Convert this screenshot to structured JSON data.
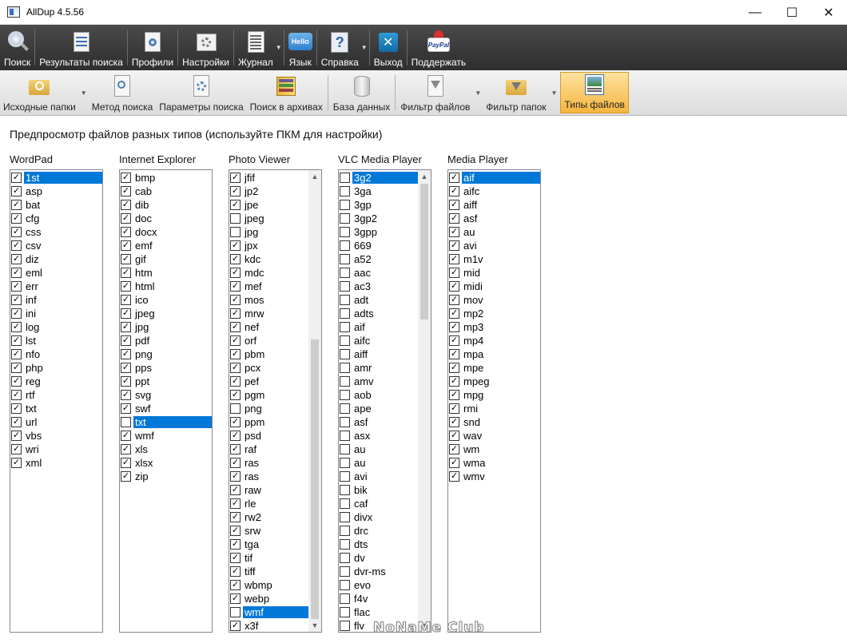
{
  "window": {
    "title": "AllDup 4.5.56",
    "controls": {
      "minimize": "—",
      "maximize": "☐",
      "close": "✕"
    }
  },
  "toolbar_main": {
    "items": [
      {
        "label": "Поиск",
        "icon": "magnifier-icon",
        "dropdown": false
      },
      {
        "label": "Результаты поиска",
        "icon": "results-icon",
        "dropdown": false
      },
      {
        "label": "Профили",
        "icon": "profiles-icon",
        "dropdown": false
      },
      {
        "label": "Настройки",
        "icon": "settings-icon",
        "dropdown": false
      },
      {
        "label": "Журнал",
        "icon": "log-icon",
        "dropdown": true
      },
      {
        "label": "Язык",
        "icon": "language-hello-icon",
        "dropdown": false
      },
      {
        "label": "Справка",
        "icon": "help-icon",
        "dropdown": true
      },
      {
        "label": "Выход",
        "icon": "exit-icon",
        "dropdown": false
      },
      {
        "label": "Поддержать",
        "icon": "paypal-icon",
        "dropdown": false
      }
    ]
  },
  "toolbar_secondary": {
    "items": [
      {
        "label": "Исходные папки",
        "icon": "source-folders-icon",
        "dropdown": true,
        "active": false
      },
      {
        "label": "Метод поиска",
        "icon": "search-method-icon",
        "dropdown": false,
        "active": false
      },
      {
        "label": "Параметры поиска",
        "icon": "search-params-icon",
        "dropdown": false,
        "active": false
      },
      {
        "label": "Поиск в архивах",
        "icon": "archive-icon",
        "dropdown": false,
        "active": false
      },
      {
        "label": "База данных",
        "icon": "database-icon",
        "dropdown": false,
        "active": false
      },
      {
        "label": "Фильтр файлов",
        "icon": "file-filter-icon",
        "dropdown": true,
        "active": false
      },
      {
        "label": "Фильтр папок",
        "icon": "folder-filter-icon",
        "dropdown": true,
        "active": false
      },
      {
        "label": "Типы файлов",
        "icon": "file-types-icon",
        "dropdown": false,
        "active": true
      }
    ]
  },
  "content": {
    "heading": "Предпросмотр файлов разных типов (используйте ПКМ для настройки)",
    "columns": [
      {
        "label": "WordPad",
        "scrollbar": false,
        "items": [
          {
            "ext": "1st",
            "checked": true,
            "selected": true
          },
          {
            "ext": "asp",
            "checked": true
          },
          {
            "ext": "bat",
            "checked": true
          },
          {
            "ext": "cfg",
            "checked": true
          },
          {
            "ext": "css",
            "checked": true
          },
          {
            "ext": "csv",
            "checked": true
          },
          {
            "ext": "diz",
            "checked": true
          },
          {
            "ext": "eml",
            "checked": true
          },
          {
            "ext": "err",
            "checked": true
          },
          {
            "ext": "inf",
            "checked": true
          },
          {
            "ext": "ini",
            "checked": true
          },
          {
            "ext": "log",
            "checked": true
          },
          {
            "ext": "lst",
            "checked": true
          },
          {
            "ext": "nfo",
            "checked": true
          },
          {
            "ext": "php",
            "checked": true
          },
          {
            "ext": "reg",
            "checked": true
          },
          {
            "ext": "rtf",
            "checked": true
          },
          {
            "ext": "txt",
            "checked": true
          },
          {
            "ext": "url",
            "checked": true
          },
          {
            "ext": "vbs",
            "checked": true
          },
          {
            "ext": "wri",
            "checked": true
          },
          {
            "ext": "xml",
            "checked": true
          }
        ]
      },
      {
        "label": "Internet Explorer",
        "scrollbar": false,
        "items": [
          {
            "ext": "bmp",
            "checked": true
          },
          {
            "ext": "cab",
            "checked": true
          },
          {
            "ext": "dib",
            "checked": true
          },
          {
            "ext": "doc",
            "checked": true
          },
          {
            "ext": "docx",
            "checked": true
          },
          {
            "ext": "emf",
            "checked": true
          },
          {
            "ext": "gif",
            "checked": true
          },
          {
            "ext": "htm",
            "checked": true
          },
          {
            "ext": "html",
            "checked": true
          },
          {
            "ext": "ico",
            "checked": true
          },
          {
            "ext": "jpeg",
            "checked": true
          },
          {
            "ext": "jpg",
            "checked": true
          },
          {
            "ext": "pdf",
            "checked": true
          },
          {
            "ext": "png",
            "checked": true
          },
          {
            "ext": "pps",
            "checked": true
          },
          {
            "ext": "ppt",
            "checked": true
          },
          {
            "ext": "svg",
            "checked": true
          },
          {
            "ext": "swf",
            "checked": true
          },
          {
            "ext": "txt",
            "checked": false,
            "selected": true
          },
          {
            "ext": "wmf",
            "checked": true
          },
          {
            "ext": "xls",
            "checked": true
          },
          {
            "ext": "xlsx",
            "checked": true
          },
          {
            "ext": "zip",
            "checked": true
          }
        ]
      },
      {
        "label": "Photo Viewer",
        "scrollbar": true,
        "items": [
          {
            "ext": "jfif",
            "checked": true
          },
          {
            "ext": "jp2",
            "checked": true
          },
          {
            "ext": "jpe",
            "checked": true
          },
          {
            "ext": "jpeg",
            "checked": false
          },
          {
            "ext": "jpg",
            "checked": false
          },
          {
            "ext": "jpx",
            "checked": true
          },
          {
            "ext": "kdc",
            "checked": true
          },
          {
            "ext": "mdc",
            "checked": true
          },
          {
            "ext": "mef",
            "checked": true
          },
          {
            "ext": "mos",
            "checked": true
          },
          {
            "ext": "mrw",
            "checked": true
          },
          {
            "ext": "nef",
            "checked": true
          },
          {
            "ext": "orf",
            "checked": true
          },
          {
            "ext": "pbm",
            "checked": true
          },
          {
            "ext": "pcx",
            "checked": true
          },
          {
            "ext": "pef",
            "checked": true
          },
          {
            "ext": "pgm",
            "checked": true
          },
          {
            "ext": "png",
            "checked": false
          },
          {
            "ext": "ppm",
            "checked": true
          },
          {
            "ext": "psd",
            "checked": true
          },
          {
            "ext": "raf",
            "checked": true
          },
          {
            "ext": "ras",
            "checked": true
          },
          {
            "ext": "ras",
            "checked": true
          },
          {
            "ext": "raw",
            "checked": true
          },
          {
            "ext": "rle",
            "checked": true
          },
          {
            "ext": "rw2",
            "checked": true
          },
          {
            "ext": "srw",
            "checked": true
          },
          {
            "ext": "tga",
            "checked": true
          },
          {
            "ext": "tif",
            "checked": true
          },
          {
            "ext": "tiff",
            "checked": true
          },
          {
            "ext": "wbmp",
            "checked": true
          },
          {
            "ext": "webp",
            "checked": true
          },
          {
            "ext": "wmf",
            "checked": false,
            "selected": true
          },
          {
            "ext": "x3f",
            "checked": true
          }
        ]
      },
      {
        "label": "VLC Media Player",
        "scrollbar": true,
        "items": [
          {
            "ext": "3g2",
            "checked": false,
            "selected": true
          },
          {
            "ext": "3ga",
            "checked": false
          },
          {
            "ext": "3gp",
            "checked": false
          },
          {
            "ext": "3gp2",
            "checked": false
          },
          {
            "ext": "3gpp",
            "checked": false
          },
          {
            "ext": "669",
            "checked": false
          },
          {
            "ext": "a52",
            "checked": false
          },
          {
            "ext": "aac",
            "checked": false
          },
          {
            "ext": "ac3",
            "checked": false
          },
          {
            "ext": "adt",
            "checked": false
          },
          {
            "ext": "adts",
            "checked": false
          },
          {
            "ext": "aif",
            "checked": false
          },
          {
            "ext": "aifc",
            "checked": false
          },
          {
            "ext": "aiff",
            "checked": false
          },
          {
            "ext": "amr",
            "checked": false
          },
          {
            "ext": "amv",
            "checked": false
          },
          {
            "ext": "aob",
            "checked": false
          },
          {
            "ext": "ape",
            "checked": false
          },
          {
            "ext": "asf",
            "checked": false
          },
          {
            "ext": "asx",
            "checked": false
          },
          {
            "ext": "au",
            "checked": false
          },
          {
            "ext": "au",
            "checked": false
          },
          {
            "ext": "avi",
            "checked": false
          },
          {
            "ext": "bik",
            "checked": false
          },
          {
            "ext": "caf",
            "checked": false
          },
          {
            "ext": "divx",
            "checked": false
          },
          {
            "ext": "drc",
            "checked": false
          },
          {
            "ext": "dts",
            "checked": false
          },
          {
            "ext": "dv",
            "checked": false
          },
          {
            "ext": "dvr-ms",
            "checked": false
          },
          {
            "ext": "evo",
            "checked": false
          },
          {
            "ext": "f4v",
            "checked": false
          },
          {
            "ext": "flac",
            "checked": false
          },
          {
            "ext": "flv",
            "checked": false
          }
        ]
      },
      {
        "label": "Media Player",
        "scrollbar": false,
        "items": [
          {
            "ext": "aif",
            "checked": true,
            "selected": true
          },
          {
            "ext": "aifc",
            "checked": true
          },
          {
            "ext": "aiff",
            "checked": true
          },
          {
            "ext": "asf",
            "checked": true
          },
          {
            "ext": "au",
            "checked": true
          },
          {
            "ext": "avi",
            "checked": true
          },
          {
            "ext": "m1v",
            "checked": true
          },
          {
            "ext": "mid",
            "checked": true
          },
          {
            "ext": "midi",
            "checked": true
          },
          {
            "ext": "mov",
            "checked": true
          },
          {
            "ext": "mp2",
            "checked": true
          },
          {
            "ext": "mp3",
            "checked": true
          },
          {
            "ext": "mp4",
            "checked": true
          },
          {
            "ext": "mpa",
            "checked": true
          },
          {
            "ext": "mpe",
            "checked": true
          },
          {
            "ext": "mpeg",
            "checked": true
          },
          {
            "ext": "mpg",
            "checked": true
          },
          {
            "ext": "rmi",
            "checked": true
          },
          {
            "ext": "snd",
            "checked": true
          },
          {
            "ext": "wav",
            "checked": true
          },
          {
            "ext": "wm",
            "checked": true
          },
          {
            "ext": "wma",
            "checked": true
          },
          {
            "ext": "wmv",
            "checked": true
          }
        ]
      }
    ]
  },
  "watermark": "NoNaMe Club",
  "colors": {
    "selection": "#0078d7",
    "toolbar_dark": "#3a3a3a",
    "active_tab": "#f6b53f"
  }
}
